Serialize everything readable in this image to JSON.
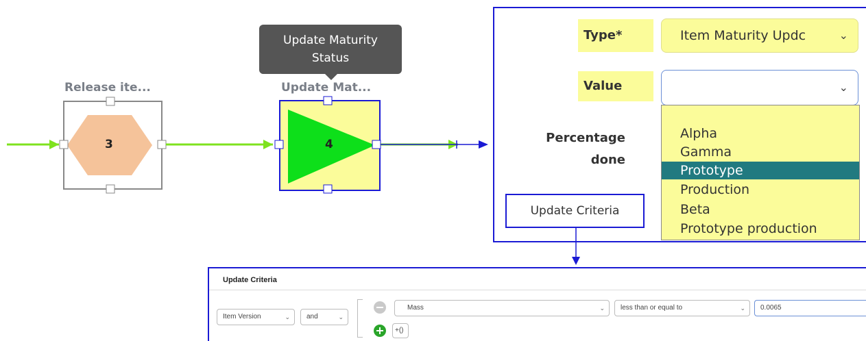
{
  "flow": {
    "node3": {
      "title": "Release ite...",
      "number": "3",
      "color": "#f5c39a"
    },
    "node4": {
      "title": "Update Mat...",
      "number": "4",
      "color": "#0ddf1a"
    },
    "tooltip": {
      "line1": "Update Maturity",
      "line2": "Status"
    }
  },
  "form": {
    "type_label": "Type*",
    "type_value": "Item Maturity Updc",
    "value_label": "Value",
    "value_value": "",
    "percentage_label_1": "Percentage",
    "percentage_label_2": "done",
    "options": [
      "Alpha",
      "Gamma",
      "Prototype",
      "Production",
      "Beta",
      "Prototype production"
    ],
    "selected_option": "Prototype",
    "update_criteria_button": "Update Criteria"
  },
  "criteria": {
    "title": "Update Criteria",
    "property": "Item Version",
    "logic": "and",
    "attribute": "Mass",
    "operator": "less than or equal to",
    "value": "0.0065",
    "group_button": "+()"
  },
  "colors": {
    "highlight": "#fbfc9a",
    "selected": "#217a80",
    "accent_blue": "#1a1ad4",
    "connector_green": "#7ee21e"
  }
}
